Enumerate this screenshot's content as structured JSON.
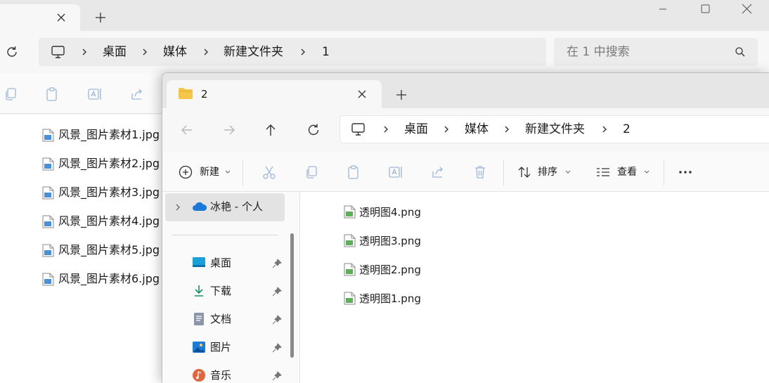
{
  "back_window": {
    "address_crumbs": [
      "桌面",
      "媒体",
      "新建文件夹",
      "1"
    ],
    "search_placeholder": "在 1 中搜索",
    "files": [
      "风景_图片素材1.jpg",
      "风景_图片素材2.jpg",
      "风景_图片素材3.jpg",
      "风景_图片素材4.jpg",
      "风景_图片素材5.jpg",
      "风景_图片素材6.jpg"
    ]
  },
  "front_window": {
    "tab_title": "2",
    "address_crumbs": [
      "桌面",
      "媒体",
      "新建文件夹",
      "2"
    ],
    "toolbar": {
      "new_label": "新建",
      "sort_label": "排序",
      "view_label": "查看"
    },
    "nav": {
      "onedrive_label": "冰艳 - 个人",
      "items": [
        {
          "label": "桌面",
          "icon": "desktop-icon"
        },
        {
          "label": "下载",
          "icon": "download-icon"
        },
        {
          "label": "文档",
          "icon": "documents-icon"
        },
        {
          "label": "图片",
          "icon": "pictures-icon"
        },
        {
          "label": "音乐",
          "icon": "music-icon"
        }
      ]
    },
    "files": [
      "透明图4.png",
      "透明图3.png",
      "透明图2.png",
      "透明图1.png"
    ]
  },
  "colors": {
    "accent": "#0067c0",
    "folder": "#f4c64a"
  }
}
